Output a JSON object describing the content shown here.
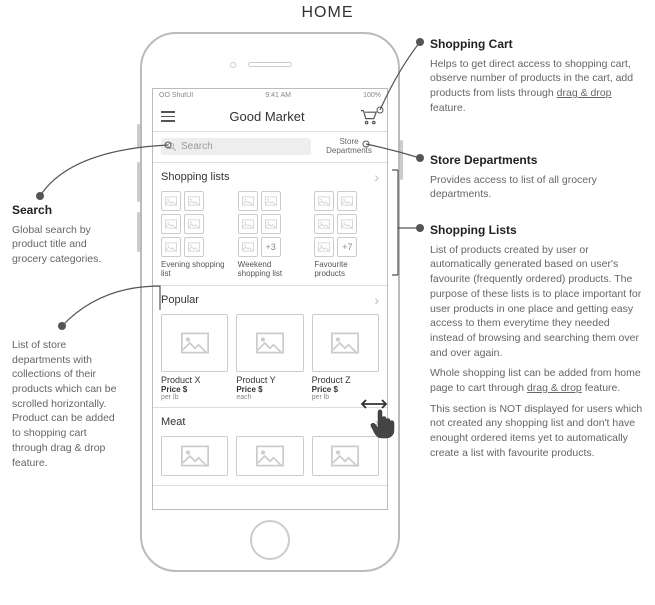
{
  "page_title": "HOME",
  "phone": {
    "status": {
      "carrier": "OO ShutUI",
      "time": "9:41 AM",
      "battery": "100%"
    },
    "app_title": "Good Market",
    "search_placeholder": "Search",
    "store_dept_label": "Store\nDepartments"
  },
  "sections": {
    "shopping_lists": {
      "title": "Shopping lists",
      "lists": [
        {
          "label": "Evening shopping list",
          "extra": ""
        },
        {
          "label": "Weekend shopping list",
          "extra": "+3"
        },
        {
          "label": "Favourite products",
          "extra": "+7"
        }
      ]
    },
    "popular": {
      "title": "Popular",
      "products": [
        {
          "name": "Product X",
          "price": "Price $",
          "unit": "per lb"
        },
        {
          "name": "Product Y",
          "price": "Price $",
          "unit": "each"
        },
        {
          "name": "Product Z",
          "price": "Price $",
          "unit": "per lb"
        }
      ]
    },
    "meat": {
      "title": "Meat"
    }
  },
  "annotations": {
    "search": {
      "title": "Search",
      "body": "Global search by product title and grocery categories."
    },
    "departments_left": {
      "body": "List of store departments with collections of their products which can be scrolled horizontally. Product can be added to shopping cart through drag & drop feature."
    },
    "cart": {
      "title": "Shopping Cart",
      "body": "Helps to get direct access to shopping cart, observe number of products in the cart, add products from lists through drag & drop feature."
    },
    "store_dept": {
      "title": "Store Departments",
      "body": "Provides access to list of all grocery departments."
    },
    "lists": {
      "title": "Shopping Lists",
      "body1": "List of products created by user or automatically generated based on user's favourite (frequently ordered) products. The purpose of these lists is to place important for user products in one place and getting easy access to them everytime they needed instead of browsing and searching them over and over again.",
      "body2": "Whole shopping list can be added from home page to cart through drag & drop feature.",
      "body3": "This section is NOT displayed for users which not created any shopping list and don't have enought ordered items yet to automatically create a list with favourite products."
    }
  }
}
